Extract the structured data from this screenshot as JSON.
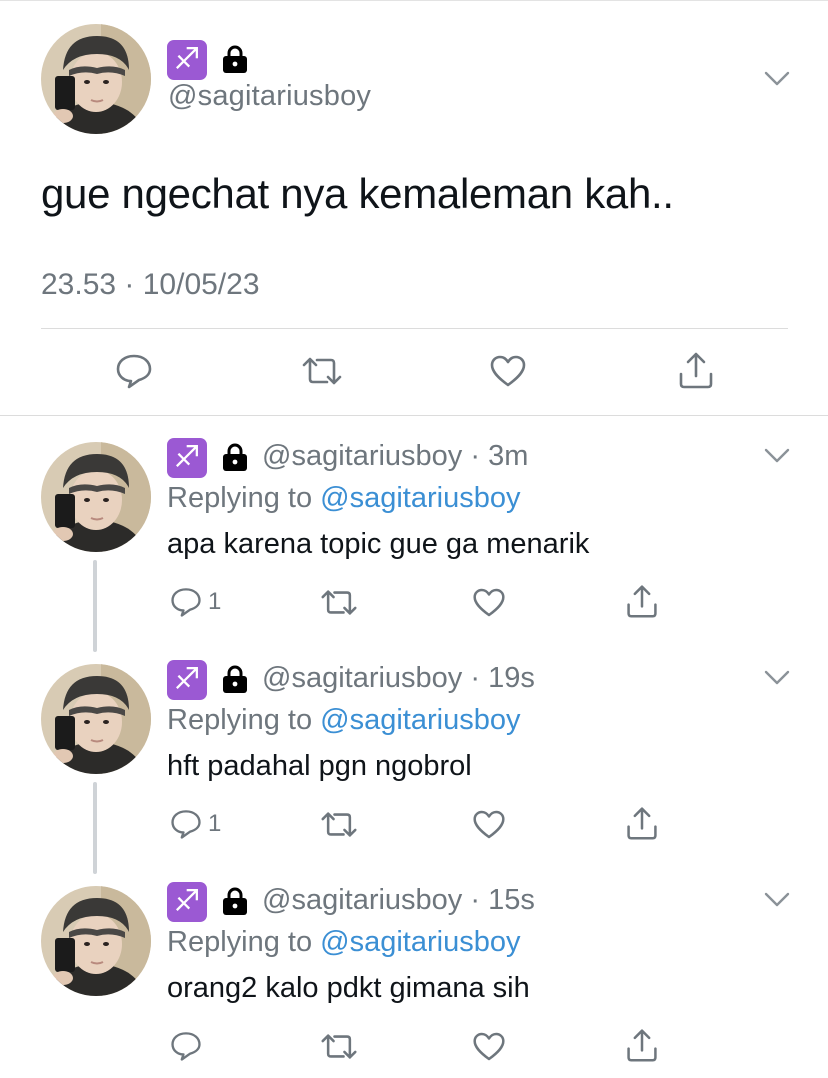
{
  "main": {
    "badge_emoji": "♐",
    "handle": "@sagitariusboy",
    "text": "gue ngechat nya kemaleman kah..",
    "timestamp": "23.53 · 10/05/23"
  },
  "replies": [
    {
      "badge_emoji": "♐",
      "handle": "@sagitariusboy",
      "time": "· 3m",
      "replying_label": "Replying to",
      "replying_to": "@sagitariusboy",
      "text": "apa karena topic gue ga menarik",
      "reply_count": "1"
    },
    {
      "badge_emoji": "♐",
      "handle": "@sagitariusboy",
      "time": "· 19s",
      "replying_label": "Replying to",
      "replying_to": "@sagitariusboy",
      "text": "hft padahal pgn ngobrol",
      "reply_count": "1"
    },
    {
      "badge_emoji": "♐",
      "handle": "@sagitariusboy",
      "time": "· 15s",
      "replying_label": "Replying to",
      "replying_to": "@sagitariusboy",
      "text": "orang2 kalo pdkt gimana sih",
      "reply_count": ""
    }
  ],
  "icons": {
    "reply": "speech-bubble-icon",
    "retweet": "retweet-icon",
    "like": "heart-icon",
    "share": "share-icon",
    "lock": "lock-icon",
    "more": "chevron-down-icon"
  },
  "colors": {
    "link": "#3b8fd4",
    "secondary_text": "#6e767d",
    "badge": "#9b59d3"
  }
}
